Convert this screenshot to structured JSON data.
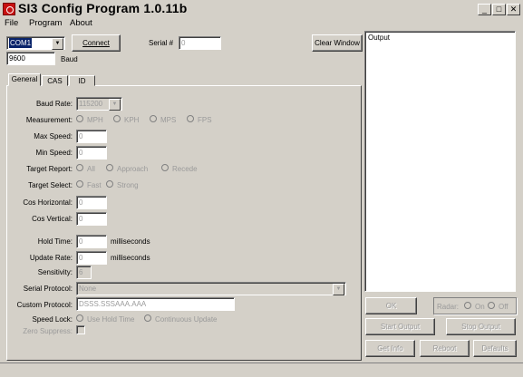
{
  "window": {
    "title": "SI3 Config Program 1.0.11b",
    "min": "_",
    "max": "□",
    "close": "✕"
  },
  "menu": [
    "File",
    "Program",
    "About"
  ],
  "connection": {
    "port": "COM1",
    "connect": "Connect",
    "serial_label": "Serial #",
    "serial_value": "0",
    "baud_value": "9600",
    "baud_label": "Baud",
    "clear": "Clear Window"
  },
  "tabs": [
    "General",
    "CAS",
    "ID"
  ],
  "general": {
    "baud_rate_label": "Baud Rate:",
    "baud_rate_value": "115200",
    "measurement_label": "Measurement:",
    "measurement_options": [
      "MPH",
      "KPH",
      "MPS",
      "FPS"
    ],
    "max_speed_label": "Max Speed:",
    "max_speed_value": "0",
    "min_speed_label": "Min Speed:",
    "min_speed_value": "0",
    "target_report_label": "Target Report:",
    "target_report_options": [
      "All",
      "Approach",
      "Recede"
    ],
    "target_select_label": "Target Select:",
    "target_select_options": [
      "Fast",
      "Strong"
    ],
    "cos_h_label": "Cos Horizontal:",
    "cos_h_value": "0",
    "cos_v_label": "Cos Vertical:",
    "cos_v_value": "0",
    "hold_time_label": "Hold Time:",
    "hold_time_value": "0",
    "hold_time_unit": "milliseconds",
    "update_rate_label": "Update Rate:",
    "update_rate_value": "0",
    "update_rate_unit": "milliseconds",
    "sensitivity_label": "Sensitivity:",
    "sensitivity_value": "6",
    "serial_protocol_label": "Serial Protocol:",
    "serial_protocol_value": "None",
    "custom_protocol_label": "Custom Protocol:",
    "custom_protocol_value": "DSSS.SSSAAA.AAA",
    "speed_lock_label": "Speed Lock:",
    "speed_lock_options": [
      "Use Hold Time",
      "Continuous Update"
    ],
    "zero_suppress_label": "Zero Suppress:"
  },
  "output": {
    "label": "Output"
  },
  "actions": {
    "ok": "OK",
    "radar_label": "Radar:",
    "radar_on": "On",
    "radar_off": "Off",
    "start": "Start Output",
    "stop": "Stop Output",
    "get_info": "Get Info",
    "reboot": "Reboot",
    "defaults": "Defaults"
  }
}
